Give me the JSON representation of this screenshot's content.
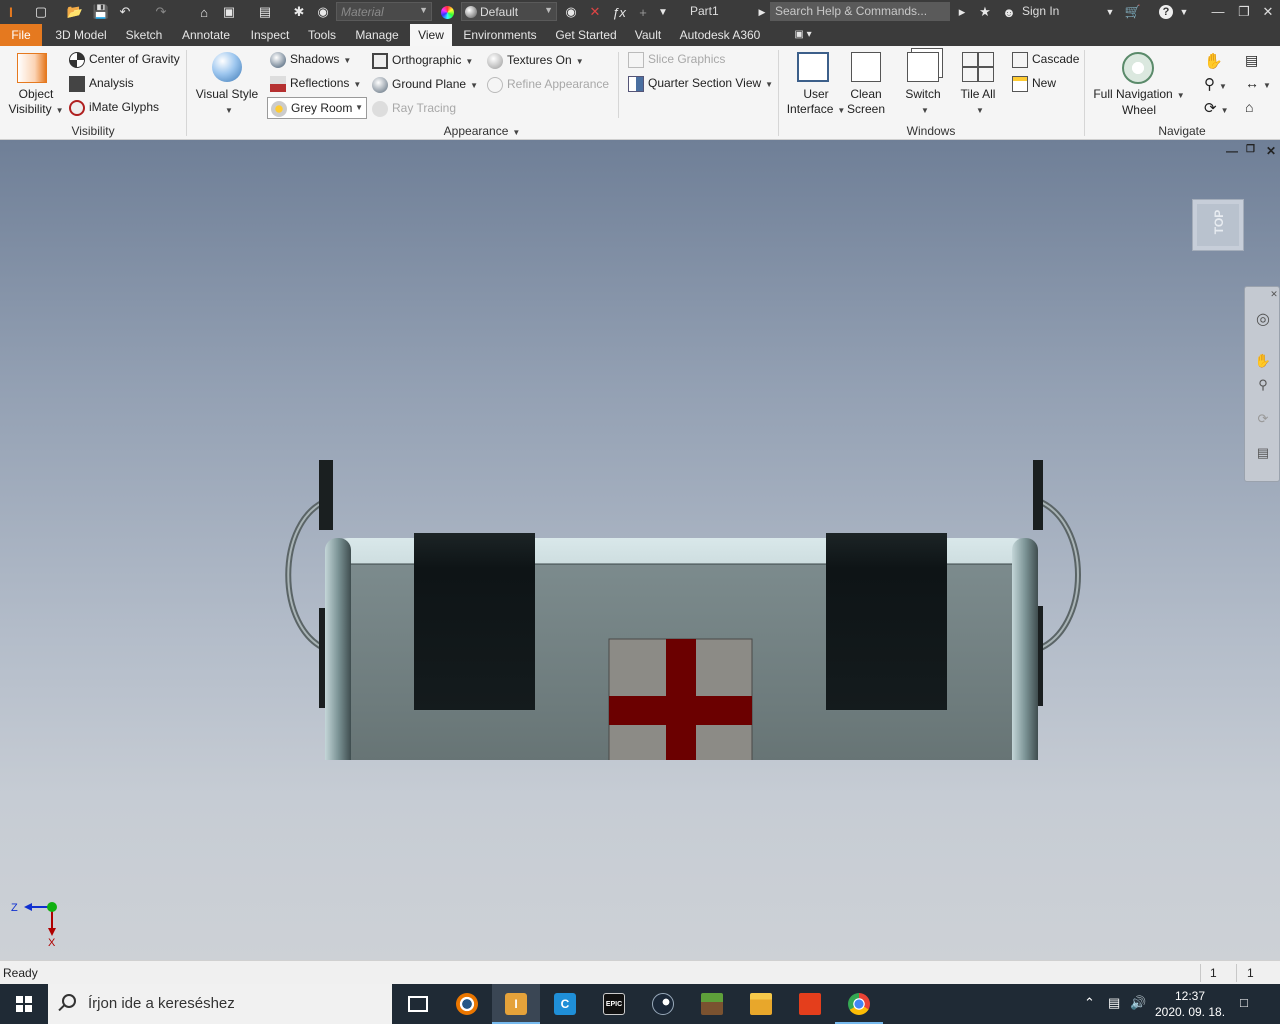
{
  "titlebar": {
    "material_placeholder": "Material",
    "appearance_value": "Default",
    "document_title": "Part1",
    "search_placeholder": "Search Help & Commands...",
    "sign_in": "Sign In"
  },
  "menu": {
    "tabs": [
      "File",
      "3D Model",
      "Sketch",
      "Annotate",
      "Inspect",
      "Tools",
      "Manage",
      "View",
      "Environments",
      "Get Started",
      "Vault",
      "Autodesk A360"
    ],
    "active_tab": "View"
  },
  "ribbon": {
    "visibility": {
      "object_visibility_l1": "Object",
      "object_visibility_l2": "Visibility",
      "center_of_gravity": "Center of Gravity",
      "analysis": "Analysis",
      "imate_glyphs": "iMate Glyphs",
      "panel_title": "Visibility"
    },
    "appearance": {
      "visual_style": "Visual Style",
      "shadows": "Shadows",
      "reflections": "Reflections",
      "lighting_style": "Grey Room",
      "orthographic": "Orthographic",
      "ground_plane": "Ground Plane",
      "ray_tracing": "Ray Tracing",
      "textures_on": "Textures On",
      "refine_appearance": "Refine Appearance",
      "slice_graphics": "Slice Graphics",
      "quarter_section_view": "Quarter Section View",
      "panel_title": "Appearance"
    },
    "windows": {
      "user_interface_l1": "User",
      "user_interface_l2": "Interface",
      "clean_screen_l1": "Clean",
      "clean_screen_l2": "Screen",
      "switch": "Switch",
      "tile_all": "Tile All",
      "cascade": "Cascade",
      "new": "New",
      "panel_title": "Windows"
    },
    "navigate": {
      "full_nav_wheel_l1": "Full Navigation",
      "full_nav_wheel_l2": "Wheel",
      "panel_title": "Navigate"
    }
  },
  "viewport": {
    "viewcube_face": "TOP",
    "triad_z": "Z",
    "triad_x": "X"
  },
  "statusbar": {
    "status": "Ready",
    "num1": "1",
    "num2": "1"
  },
  "taskbar": {
    "search_placeholder": "Írjon ide a kereséshez",
    "time": "12:37",
    "date": "2020. 09. 18.",
    "apps": [
      "task-view",
      "blender",
      "autodesk-inventor",
      "ccleaner",
      "epic-games",
      "steam",
      "minecraft",
      "file-explorer",
      "microsoft-office",
      "google-chrome"
    ]
  },
  "colors": {
    "file_tab": "#e5791f",
    "titlebar": "#3b3b3b",
    "cross_red": "#6b0000",
    "taskbar": "#1f2a35"
  }
}
